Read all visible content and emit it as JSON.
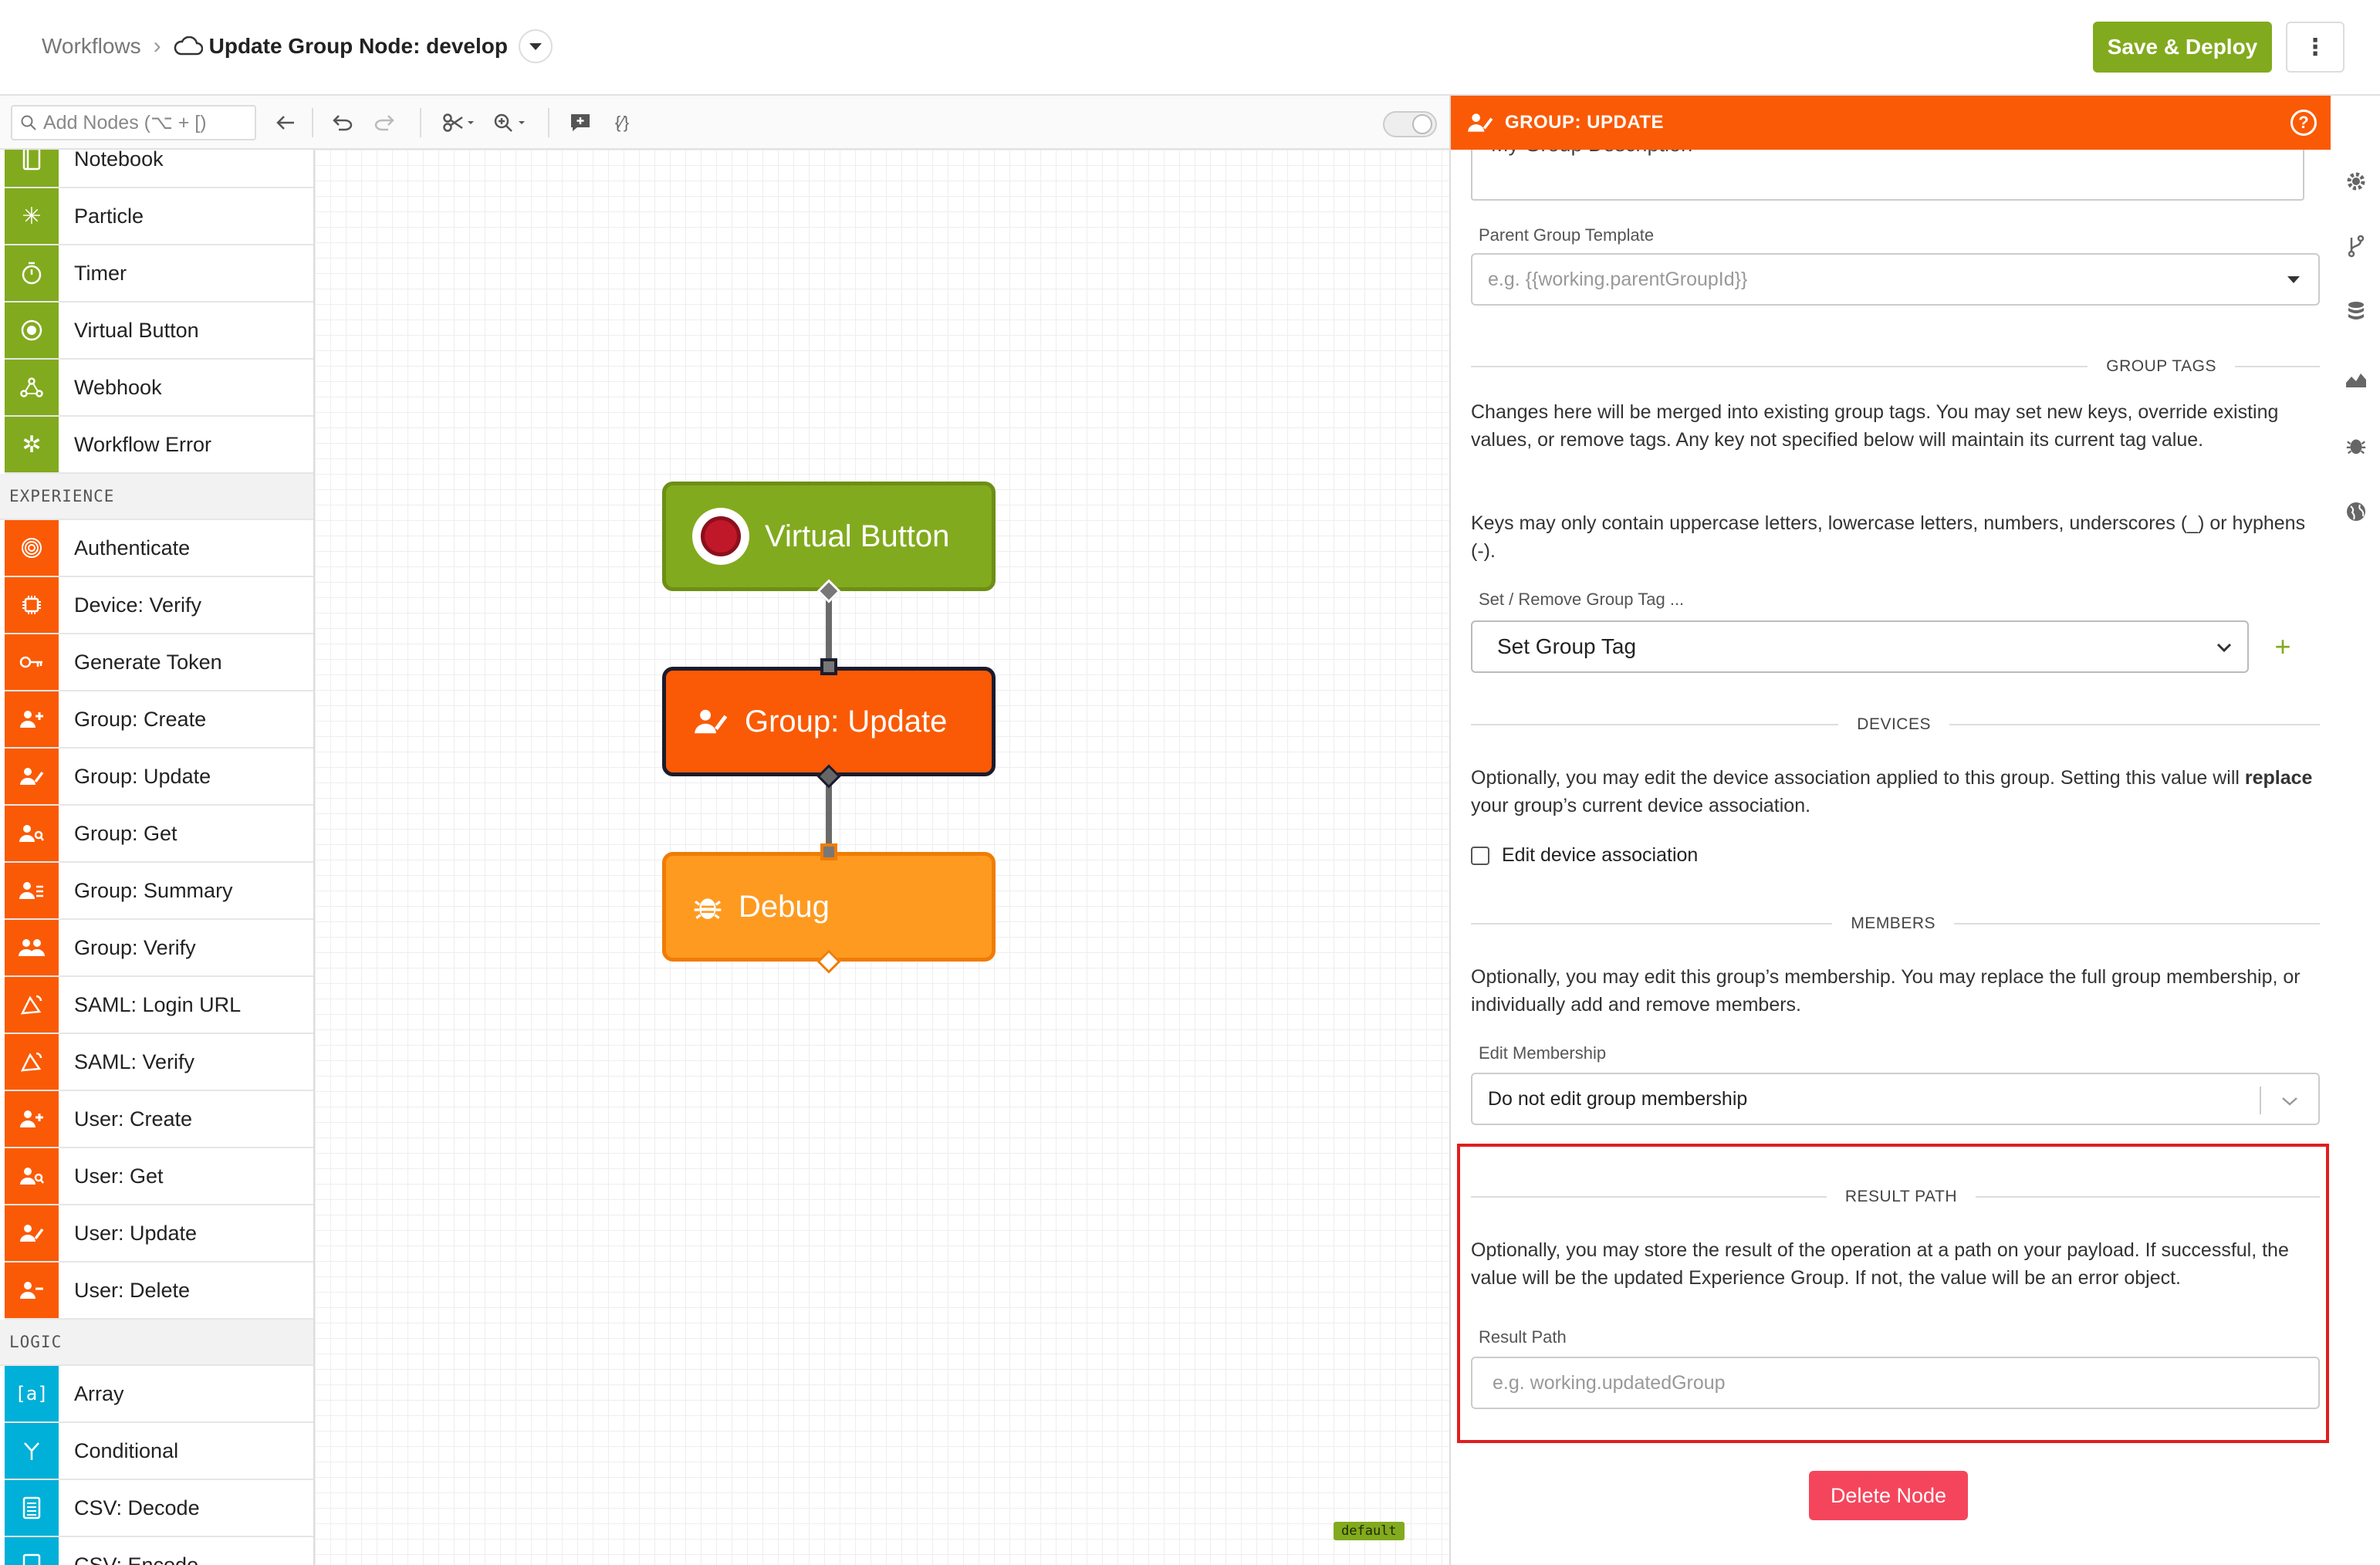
{
  "header": {
    "breadcrumb_root": "Workflows",
    "breadcrumb_sep": "›",
    "title": "Update Group Node: develop",
    "save_label": "Save & Deploy",
    "more_label": "⋮"
  },
  "toolbar": {
    "search_placeholder": "Add Nodes (⌥ + [)",
    "expression_icon": "{⁄}"
  },
  "sidebar": {
    "triggers": [
      {
        "label": "Notebook",
        "icon": "notebook-icon"
      },
      {
        "label": "Particle",
        "icon": "particle-icon"
      },
      {
        "label": "Timer",
        "icon": "timer-icon"
      },
      {
        "label": "Virtual Button",
        "icon": "virtual-button-icon"
      },
      {
        "label": "Webhook",
        "icon": "webhook-icon"
      },
      {
        "label": "Workflow Error",
        "icon": "workflow-error-icon"
      }
    ],
    "experience_title": "EXPERIENCE",
    "experience": [
      {
        "label": "Authenticate",
        "icon": "fingerprint-icon"
      },
      {
        "label": "Device: Verify",
        "icon": "chip-icon"
      },
      {
        "label": "Generate Token",
        "icon": "key-icon"
      },
      {
        "label": "Group: Create",
        "icon": "group-add-icon"
      },
      {
        "label": "Group: Update",
        "icon": "group-edit-icon"
      },
      {
        "label": "Group: Get",
        "icon": "group-search-icon"
      },
      {
        "label": "Group: Summary",
        "icon": "group-list-icon"
      },
      {
        "label": "Group: Verify",
        "icon": "group-verify-icon"
      },
      {
        "label": "SAML: Login URL",
        "icon": "saml-icon"
      },
      {
        "label": "SAML: Verify",
        "icon": "saml-verify-icon"
      },
      {
        "label": "User: Create",
        "icon": "user-add-icon"
      },
      {
        "label": "User: Get",
        "icon": "user-search-icon"
      },
      {
        "label": "User: Update",
        "icon": "user-edit-icon"
      },
      {
        "label": "User: Delete",
        "icon": "user-delete-icon"
      }
    ],
    "logic_title": "LOGIC",
    "logic": [
      {
        "label": "Array",
        "icon": "array-icon"
      },
      {
        "label": "Conditional",
        "icon": "conditional-icon"
      },
      {
        "label": "CSV: Decode",
        "icon": "csv-icon"
      },
      {
        "label": "CSV: Encode",
        "icon": "csv-encode-icon"
      }
    ]
  },
  "canvas": {
    "nodes": [
      {
        "label": "Virtual Button"
      },
      {
        "label": "Group: Update"
      },
      {
        "label": "Debug"
      }
    ],
    "default_tag": "default"
  },
  "panel": {
    "title": "GROUP: UPDATE",
    "help": "?",
    "description_value": "My Group Description",
    "parent_label": "Parent Group Template",
    "parent_placeholder": "e.g. {{working.parentGroupId}}",
    "tags_heading": "GROUP TAGS",
    "tags_text_1": "Changes here will be merged into existing group tags. You may set new keys, override existing values, or remove tags. Any key not specified below will maintain its current tag value.",
    "tags_text_2": "Keys may only contain uppercase letters, lowercase letters, numbers, underscores (_) or hyphens (-).",
    "tag_select_label": "Set / Remove Group Tag ...",
    "tag_select_value": "Set Group Tag",
    "devices_heading": "DEVICES",
    "devices_text_pre": "Optionally, you may edit the device association applied to this group. Setting this value will ",
    "devices_text_bold": "replace",
    "devices_text_post": " your group’s current device association.",
    "devices_checkbox": "Edit device association",
    "members_heading": "MEMBERS",
    "members_text": "Optionally, you may edit this group’s membership. You may replace the full group membership, or individually add and remove members.",
    "membership_label": "Edit Membership",
    "membership_value": "Do not edit group membership",
    "result_heading": "RESULT PATH",
    "result_text": "Optionally, you may store the result of the operation at a path on your payload. If successful, the value will be the updated Experience Group. If not, the value will be an error object.",
    "result_label": "Result Path",
    "result_placeholder": "e.g. working.updatedGroup",
    "delete_label": "Delete Node"
  },
  "colors": {
    "brand_green": "#82aa1e",
    "brand_orange": "#fa5a05",
    "debug_orange": "#fe9a20",
    "logic_teal": "#00b0d8",
    "delete_red": "#f5455c",
    "highlight_red": "#e01e1e"
  }
}
